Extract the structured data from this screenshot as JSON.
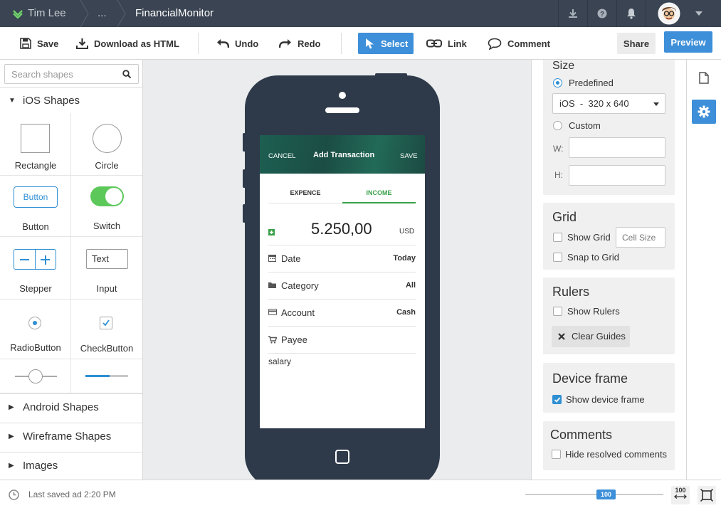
{
  "topbar": {
    "user": "Tim Lee",
    "ellipsis": "...",
    "title": "FinancialMonitor",
    "icons": [
      "download-icon",
      "help-icon",
      "bell-icon",
      "avatar",
      "caret-down-icon"
    ]
  },
  "toolbar": {
    "save": "Save",
    "download": "Download as HTML",
    "undo": "Undo",
    "redo": "Redo",
    "select": "Select",
    "link": "Link",
    "comment": "Comment",
    "share": "Share",
    "preview": "Preview",
    "accent": "#3d8fd9"
  },
  "sidebar": {
    "search_placeholder": "Search shapes",
    "ios_section": "iOS Shapes",
    "shapes": {
      "rectangle": "Rectangle",
      "circle": "Circle",
      "button": "Button",
      "button_inner": "Button",
      "switch": "Switch",
      "stepper": "Stepper",
      "input": "Input",
      "input_inner": "Text",
      "radio": "RadioButton",
      "checkbox": "CheckButton"
    },
    "sections": [
      "Android Shapes",
      "Wireframe Shapes",
      "Images"
    ]
  },
  "phone": {
    "header_cancel": "CANCEL",
    "header_title": "Add Transaction",
    "header_save": "SAVE",
    "tab_expense": "EXPENCE",
    "tab_income": "INCOME",
    "amount": "5.250,00",
    "currency": "USD",
    "rows": [
      {
        "label": "Date",
        "value": "Today"
      },
      {
        "label": "Category",
        "value": "All"
      },
      {
        "label": "Account",
        "value": "Cash"
      },
      {
        "label": "Payee",
        "value": ""
      }
    ],
    "note": "salary",
    "green": "#3aa14a"
  },
  "properties": {
    "size_title": "Size",
    "predefined": "Predefined",
    "device_select": "iOS  -  320 x 640",
    "custom": "Custom",
    "w_label": "W:",
    "h_label": "H:",
    "grid_title": "Grid",
    "show_grid": "Show Grid",
    "cell_size_placeholder": "Cell Size",
    "snap_to_grid": "Snap to Grid",
    "rulers_title": "Rulers",
    "show_rulers": "Show Rulers",
    "clear_guides": "Clear Guides",
    "device_frame_title": "Device frame",
    "show_device_frame": "Show device frame",
    "comments_title": "Comments",
    "hide_resolved": "Hide resolved comments"
  },
  "status": {
    "last_saved": "Last saved ad 2:20 PM",
    "zoom": "100",
    "zoom_btn": "100"
  }
}
